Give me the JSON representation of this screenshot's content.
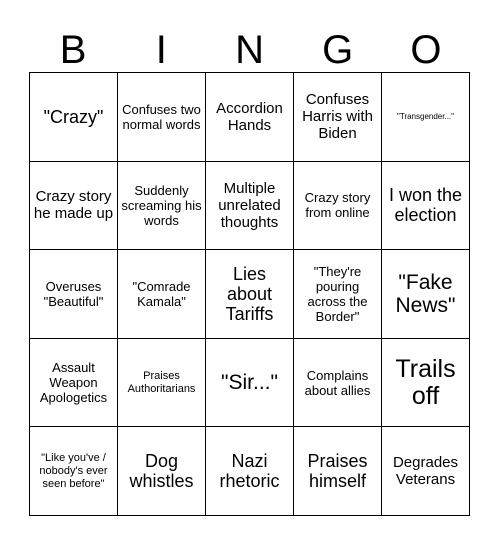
{
  "card": {
    "header_letters": [
      "B",
      "I",
      "N",
      "G",
      "O"
    ],
    "columns": 5,
    "rows": 5,
    "background_color": "#ffffff",
    "border_color": "#000000",
    "text_color": "#000000",
    "cells": [
      {
        "text": "\"Crazy\"",
        "size": "lg"
      },
      {
        "text": "Confuses two normal words",
        "size": "sm"
      },
      {
        "text": "Accordion Hands",
        "size": "md"
      },
      {
        "text": "Confuses Harris with Biden",
        "size": "md"
      },
      {
        "text": "\"Transgender...\"",
        "size": "xxs"
      },
      {
        "text": "Crazy story he made up",
        "size": "md"
      },
      {
        "text": "Suddenly screaming his words",
        "size": "sm"
      },
      {
        "text": "Multiple unrelated thoughts",
        "size": "md"
      },
      {
        "text": "Crazy story from online",
        "size": "sm"
      },
      {
        "text": "I won the election",
        "size": "lg"
      },
      {
        "text": "Overuses \"Beautiful\"",
        "size": "sm"
      },
      {
        "text": "\"Comrade Kamala\"",
        "size": "sm"
      },
      {
        "text": "Lies about Tariffs",
        "size": "lg"
      },
      {
        "text": "\"They're pouring across the Border\"",
        "size": "sm"
      },
      {
        "text": "\"Fake News\"",
        "size": "xl"
      },
      {
        "text": "Assault Weapon Apologetics",
        "size": "sm"
      },
      {
        "text": "Praises Authoritarians",
        "size": "xs"
      },
      {
        "text": "\"Sir...\"",
        "size": "xl"
      },
      {
        "text": "Complains about allies",
        "size": "sm"
      },
      {
        "text": "Trails off",
        "size": "xxl"
      },
      {
        "text": "\"Like you've / nobody's ever seen before\"",
        "size": "xs"
      },
      {
        "text": "Dog whistles",
        "size": "lg"
      },
      {
        "text": "Nazi rhetoric",
        "size": "lg"
      },
      {
        "text": "Praises himself",
        "size": "lg"
      },
      {
        "text": "Degrades Veterans",
        "size": "md"
      }
    ]
  }
}
